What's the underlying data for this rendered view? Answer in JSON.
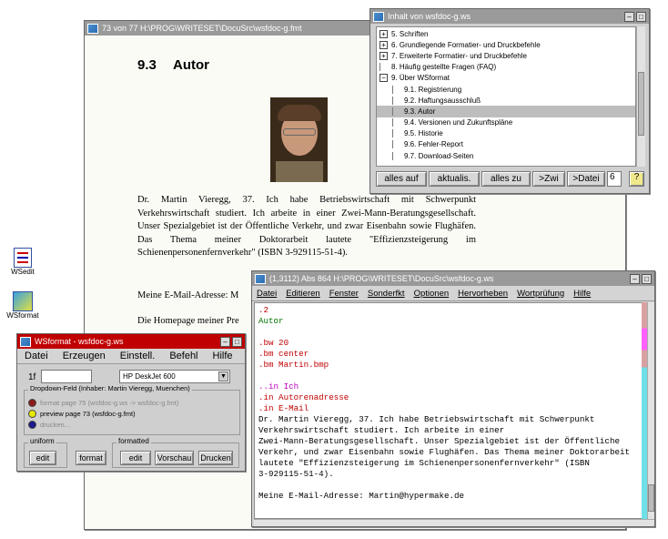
{
  "doc_window": {
    "title": "73 von 77  H:\\PROG\\WRITESET\\DocuSrc\\wsfdoc-g.fmt",
    "heading_num": "9.3",
    "heading": "Autor",
    "paragraph": "Dr. Martin Vieregg, 37. Ich habe Betriebswirtschaft mit Schwerpunkt Verkehrswirtschaft studiert. Ich arbeite in einer Zwei-Mann-Beratungsgesellschaft. Unser Spezialgebiet ist der Öffentliche Verkehr, und zwar Eisenbahn sowie Flughäfen. Das Thema meiner Doktorarbeit lautete \"Effizienzsteigerung im Schienenpersonenfernverkehr\" (ISBN 3-929115-51-4).",
    "email_line": "Meine E-Mail-Adresse: M",
    "homepage_line": "Die Homepage meiner Pre"
  },
  "toc_window": {
    "title": "Inhalt von wsfdoc-g.ws",
    "items": [
      {
        "expander": "+",
        "label": "5. Schriften"
      },
      {
        "expander": "+",
        "label": "6. Grundlegende Formatier- und Druckbefehle"
      },
      {
        "expander": "+",
        "label": "7. Erweiterte Formatier- und Druckbefehle"
      },
      {
        "expander": "",
        "label": "8. Häufig gestellte Fragen (FAQ)"
      },
      {
        "expander": "−",
        "label": "9. Über WSformat"
      },
      {
        "expander": "",
        "label": "9.1. Registrierung"
      },
      {
        "expander": "",
        "label": "9.2. Haftungsausschluß"
      },
      {
        "expander": "",
        "label": "9.3. Autor"
      },
      {
        "expander": "",
        "label": "9.4. Versionen und Zukunftspläne"
      },
      {
        "expander": "",
        "label": "9.5. Historie"
      },
      {
        "expander": "",
        "label": "9.6. Fehler-Report"
      },
      {
        "expander": "",
        "label": "9.7. Download-Seiten"
      }
    ],
    "buttons": [
      "alles auf",
      "aktualis.",
      "alles zu",
      ">Zwi",
      ">Datei"
    ],
    "number_value": "6",
    "help_label": "?"
  },
  "desktop_icons": [
    {
      "label": "WSedit"
    },
    {
      "label": "WSformat"
    }
  ],
  "wsformat_window": {
    "title": "WSformat - wsfdoc-g.ws",
    "menu": [
      "Datei",
      "Erzeugen",
      "Einstell.",
      "Befehl",
      "Hilfe"
    ],
    "field_label": "1f",
    "field_value": "",
    "printer": "HP DeskJet 600",
    "group_title": "Dropdown-Feld (Inhaber: Martin Vieregg, Muenchen)",
    "options": [
      {
        "label": "format page 75 (wsfdoc-g.ws -> wsfdoc-g.fmt)",
        "color": "#8b1a1a"
      },
      {
        "label": "preview page 73 (wsfdoc-g.fmt)",
        "color": "#e8e800"
      },
      {
        "label": "drucken...",
        "color": "#1a1a8b"
      }
    ],
    "uniform_label": "uniform",
    "formatted_label": "formatted",
    "buttons": [
      "edit",
      "format",
      "edit",
      "Vorschau",
      "Drucken"
    ]
  },
  "editor_window": {
    "title": "(1,3112) Abs 864 H:\\PROG\\WRITESET\\DocuSrc\\wsfdoc-g.ws",
    "menu": [
      "Datei",
      "Editieren",
      "Fenster",
      "Sonderfkt",
      "Optionen",
      "Hervorheben",
      "Wortprüfung",
      "Hilfe"
    ],
    "lines": [
      {
        "text": ".2",
        "color": "#c00000"
      },
      {
        "text": "Autor",
        "color": "#007000"
      },
      {
        "text": "",
        "color": "#000000"
      },
      {
        "text": ".bw 20",
        "color": "#c00000"
      },
      {
        "text": ".bm center",
        "color": "#c00000"
      },
      {
        "text": ".bm Martin.bmp",
        "color": "#c00000"
      },
      {
        "text": "",
        "color": "#000000"
      },
      {
        "text": "..in Ich",
        "color": "#c000c0"
      },
      {
        "text": ".in Autorenadresse",
        "color": "#c00000"
      },
      {
        "text": ".in E-Mail",
        "color": "#c00000"
      },
      {
        "text": "Dr. Martin Vieregg, 37. Ich habe Betriebswirtschaft mit Schwerpunkt",
        "color": "#000000"
      },
      {
        "text": "Verkehrswirtschaft studiert. Ich arbeite in einer",
        "color": "#000000"
      },
      {
        "text": "Zwei-Mann-Beratungsgesellschaft. Unser Spezialgebiet ist der Öffentliche",
        "color": "#000000"
      },
      {
        "text": "Verkehr, und zwar Eisenbahn sowie Flughäfen. Das Thema meiner Doktorarbeit",
        "color": "#000000"
      },
      {
        "text": "lautete \"Effizienzsteigerung im Schienenpersonenfernverkehr\" (ISBN",
        "color": "#000000"
      },
      {
        "text": "3-929115-51-4).",
        "color": "#000000"
      },
      {
        "text": "",
        "color": "#000000"
      },
      {
        "text": "Meine E-Mail-Adresse: Martin@hypermake.de",
        "color": "#000000"
      }
    ]
  }
}
